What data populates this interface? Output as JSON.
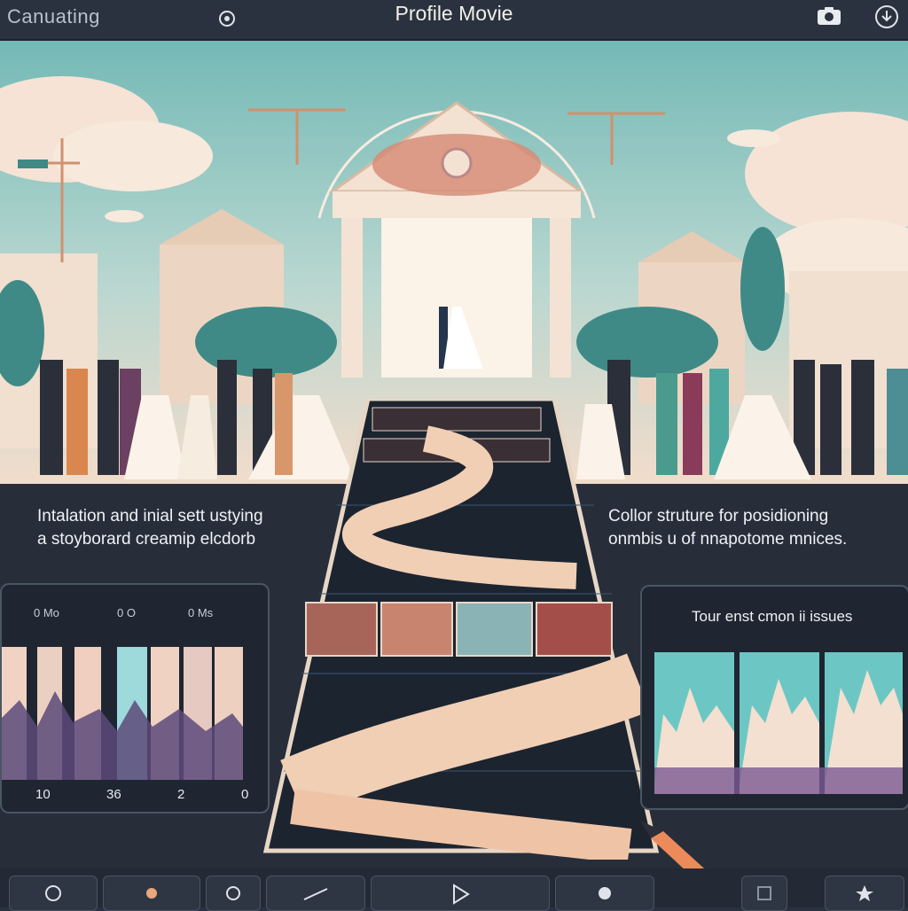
{
  "app": {
    "name": "Canuating",
    "title": "Profile Movie"
  },
  "left_text": {
    "line1": "Intalation and inial sett ustying",
    "line2": "a stoyborard creamip elcdorb"
  },
  "right_text": {
    "line1": "Collor struture for posidioning",
    "line2": "onmbis u of nnapotome mnices."
  },
  "left_panel": {
    "labels": [
      "0 Mo",
      "0 O",
      "0 Ms"
    ],
    "numbers": [
      "10",
      "36",
      "2",
      "0"
    ]
  },
  "right_panel": {
    "title": "Tour enst cmon ii issues"
  },
  "colors": {
    "accent": "#e9a77c",
    "teal": "#62c4c0",
    "purple": "#6d5b8e",
    "bg": "#2a3140"
  },
  "icons": [
    "camera-icon",
    "download-icon",
    "settings-icon",
    "play-icon",
    "pen-icon"
  ]
}
